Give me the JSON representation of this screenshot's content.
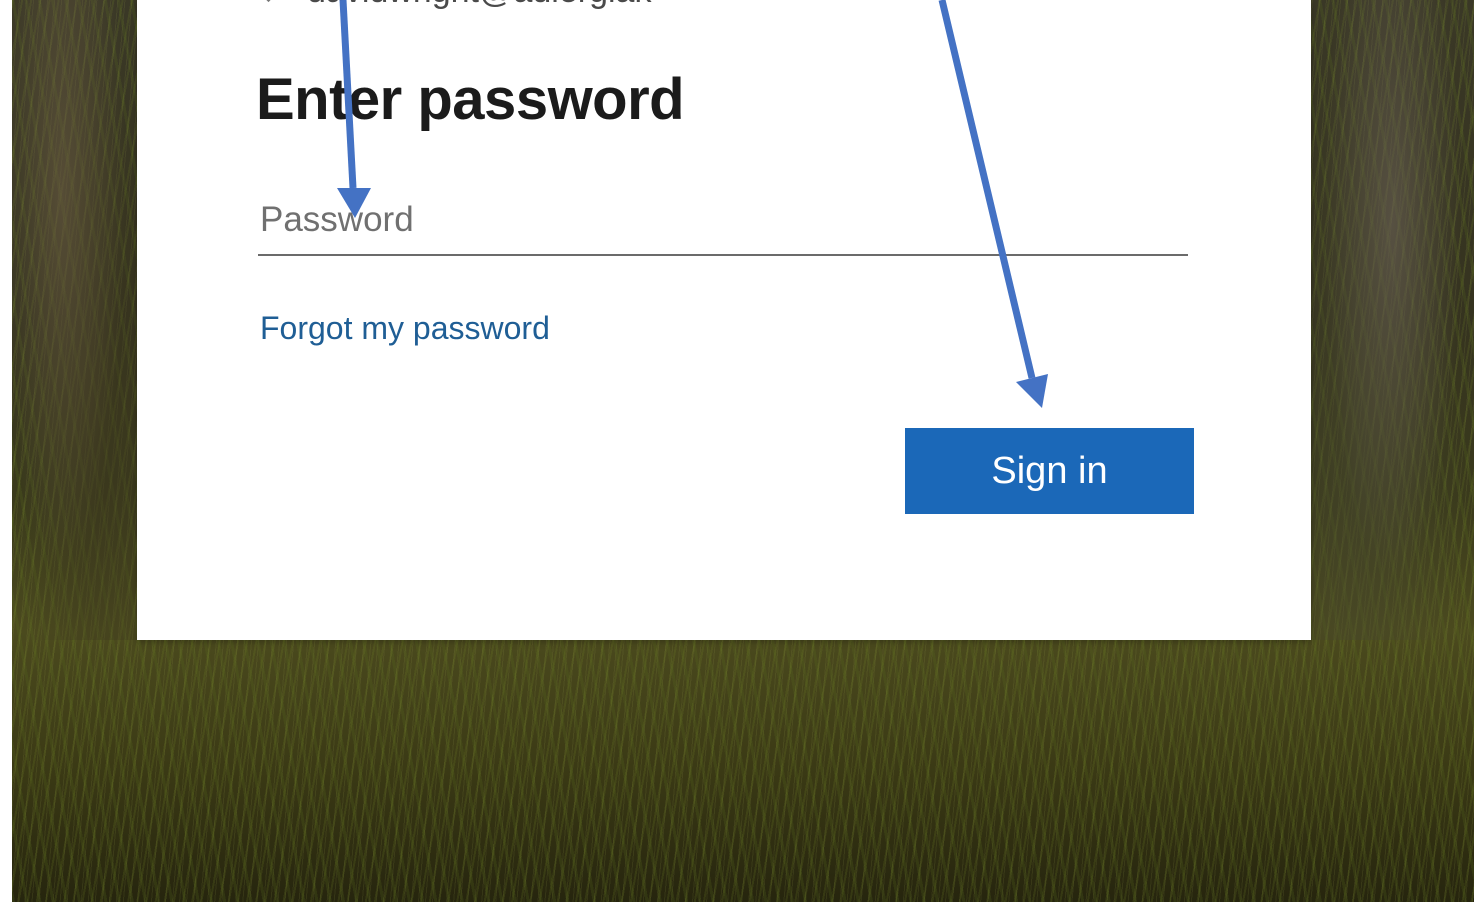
{
  "login": {
    "account_email": "davidwright@adlergiak",
    "title": "Enter password",
    "password_placeholder": "Password",
    "password_value": "",
    "forgot_link": "Forgot my password",
    "sign_in_label": "Sign in"
  },
  "colors": {
    "button_background": "#1b68b8",
    "link": "#1f5e95",
    "annotation_arrow": "#4472c4"
  },
  "icons": {
    "back": "back-arrow-icon"
  }
}
